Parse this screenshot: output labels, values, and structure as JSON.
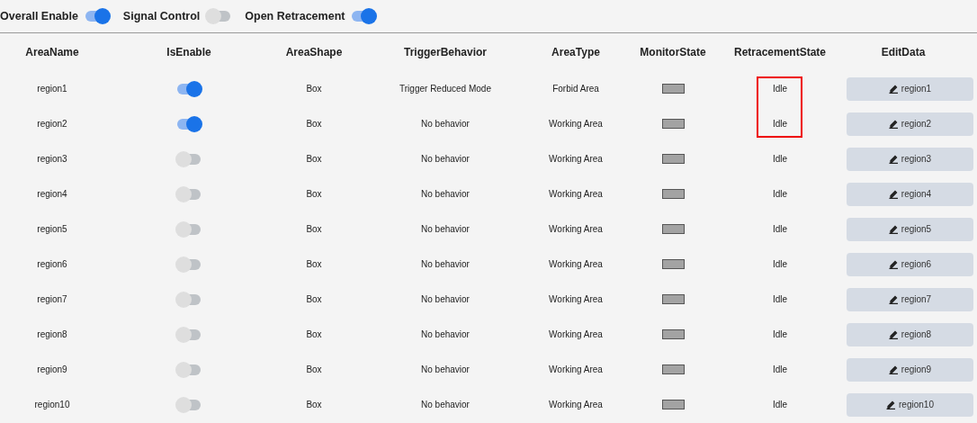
{
  "toolbar": [
    {
      "label": "Overall Enable",
      "on": true
    },
    {
      "label": "Signal Control",
      "on": false
    },
    {
      "label": "Open Retracement",
      "on": true
    }
  ],
  "table": {
    "columns": [
      "AreaName",
      "IsEnable",
      "AreaShape",
      "TriggerBehavior",
      "AreaType",
      "MonitorState",
      "RetracementState",
      "EditData"
    ],
    "rows": [
      {
        "name": "region1",
        "enabled": true,
        "shape": "Box",
        "behavior": "Trigger Reduced Mode",
        "type": "Forbid Area",
        "retracement": "Idle",
        "highlighted": true,
        "edit": "region1"
      },
      {
        "name": "region2",
        "enabled": true,
        "shape": "Box",
        "behavior": "No behavior",
        "type": "Working Area",
        "retracement": "Idle",
        "highlighted": true,
        "edit": "region2"
      },
      {
        "name": "region3",
        "enabled": false,
        "shape": "Box",
        "behavior": "No behavior",
        "type": "Working Area",
        "retracement": "Idle",
        "highlighted": false,
        "edit": "region3"
      },
      {
        "name": "region4",
        "enabled": false,
        "shape": "Box",
        "behavior": "No behavior",
        "type": "Working Area",
        "retracement": "Idle",
        "highlighted": false,
        "edit": "region4"
      },
      {
        "name": "region5",
        "enabled": false,
        "shape": "Box",
        "behavior": "No behavior",
        "type": "Working Area",
        "retracement": "Idle",
        "highlighted": false,
        "edit": "region5"
      },
      {
        "name": "region6",
        "enabled": false,
        "shape": "Box",
        "behavior": "No behavior",
        "type": "Working Area",
        "retracement": "Idle",
        "highlighted": false,
        "edit": "region6"
      },
      {
        "name": "region7",
        "enabled": false,
        "shape": "Box",
        "behavior": "No behavior",
        "type": "Working Area",
        "retracement": "Idle",
        "highlighted": false,
        "edit": "region7"
      },
      {
        "name": "region8",
        "enabled": false,
        "shape": "Box",
        "behavior": "No behavior",
        "type": "Working Area",
        "retracement": "Idle",
        "highlighted": false,
        "edit": "region8"
      },
      {
        "name": "region9",
        "enabled": false,
        "shape": "Box",
        "behavior": "No behavior",
        "type": "Working Area",
        "retracement": "Idle",
        "highlighted": false,
        "edit": "region9"
      },
      {
        "name": "region10",
        "enabled": false,
        "shape": "Box",
        "behavior": "No behavior",
        "type": "Working Area",
        "retracement": "Idle",
        "highlighted": false,
        "edit": "region10"
      }
    ]
  }
}
